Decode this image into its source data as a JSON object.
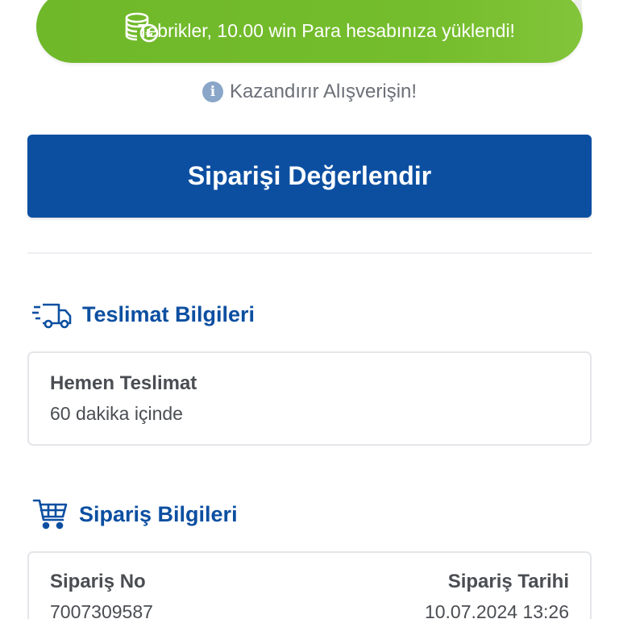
{
  "toast": {
    "message": "Tebrikler, 10.00 win Para hesabınıza yüklendi!",
    "icon": "coins-icon",
    "color": "#74bd2c"
  },
  "info": {
    "text": "Kazandırır Alışverişin!",
    "icon": "info-icon"
  },
  "rate_button": {
    "label": "Siparişi Değerlendir",
    "color": "#0c4fa1"
  },
  "delivery": {
    "section_title": "Teslimat Bilgileri",
    "icon": "delivery-truck-icon",
    "method": "Hemen Teslimat",
    "eta": "60 dakika içinde"
  },
  "order": {
    "section_title": "Sipariş Bilgileri",
    "icon": "shopping-cart-icon",
    "number_label": "Sipariş No",
    "number_value": "7007309587",
    "date_label": "Sipariş Tarihi",
    "date_value": "10.07.2024 13:26"
  }
}
